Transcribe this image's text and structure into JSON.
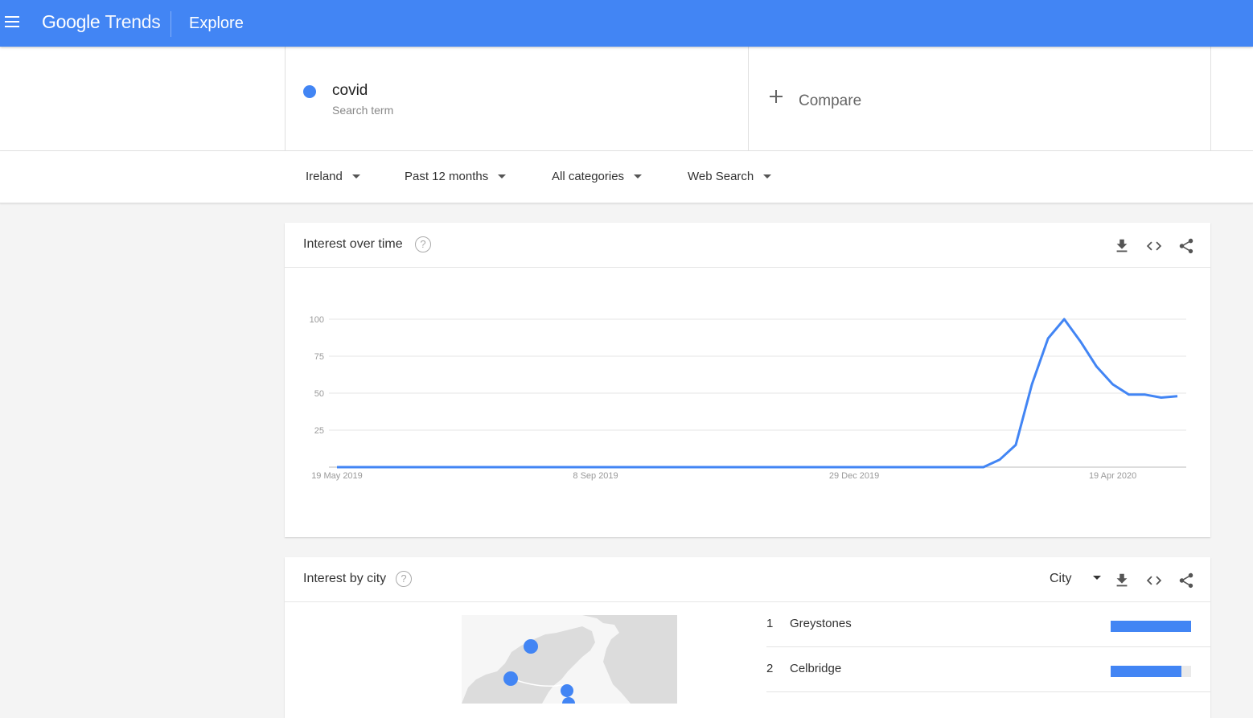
{
  "topbar": {
    "logo_google": "Google",
    "logo_trends": "Trends",
    "title": "Explore"
  },
  "term": {
    "name": "covid",
    "subtitle": "Search term",
    "dot_color": "#4285f4"
  },
  "compare": {
    "label": "Compare"
  },
  "filters": [
    {
      "label": "Ireland"
    },
    {
      "label": "Past 12 months"
    },
    {
      "label": "All categories"
    },
    {
      "label": "Web Search"
    }
  ],
  "interest_over_time": {
    "title": "Interest over time",
    "help": "?"
  },
  "chart_data": {
    "type": "line",
    "title": "Interest over time",
    "xlabel": "",
    "ylabel": "",
    "ylim": [
      0,
      100
    ],
    "yticks": [
      25,
      50,
      75,
      100
    ],
    "x_tick_labels": [
      "19 May 2019",
      "8 Sep 2019",
      "29 Dec 2019",
      "19 Apr 2020"
    ],
    "series": [
      {
        "color": "#4285f4",
        "values": [
          0,
          0,
          0,
          0,
          0,
          0,
          0,
          0,
          0,
          0,
          0,
          0,
          0,
          0,
          0,
          0,
          0,
          0,
          0,
          0,
          0,
          0,
          0,
          0,
          0,
          0,
          0,
          0,
          0,
          0,
          0,
          0,
          0,
          0,
          0,
          0,
          0,
          0,
          0,
          0,
          0,
          5,
          15,
          56,
          87,
          100,
          85,
          68,
          56,
          49,
          49,
          47,
          48
        ]
      }
    ],
    "grid": true
  },
  "interest_by_city": {
    "title": "Interest by city",
    "help": "?",
    "resolution": "City",
    "rows": [
      {
        "rank": "1",
        "name": "Greystones",
        "value": "100",
        "pct": 100
      },
      {
        "rank": "2",
        "name": "Celbridge",
        "value": "88",
        "pct": 88
      }
    ]
  }
}
